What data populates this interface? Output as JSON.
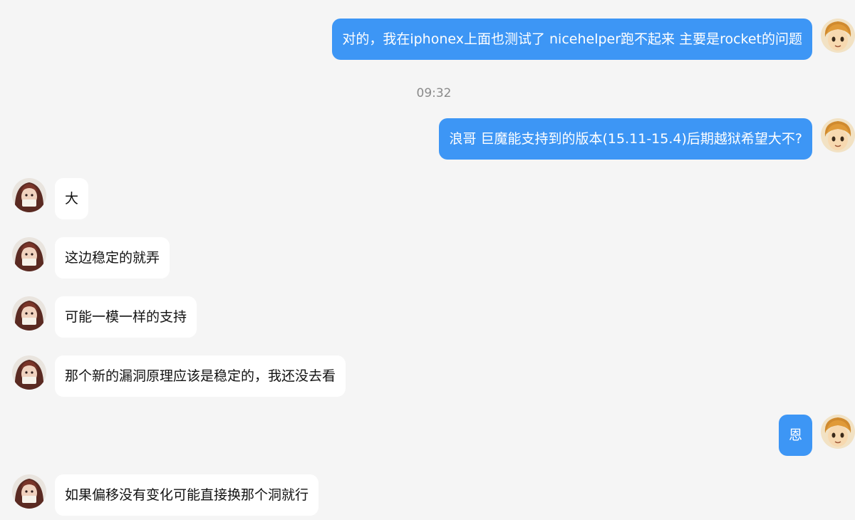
{
  "chat": {
    "messages": [
      {
        "side": "out",
        "text": "对的，我在iphonex上面也测试了 nicehelper跑不起来 主要是rocket的问题"
      },
      {
        "side": "out",
        "text": "浪哥 巨魔能支持到的版本(15.11-15.4)后期越狱希望大不?"
      },
      {
        "side": "in",
        "text": "大"
      },
      {
        "side": "in",
        "text": "这边稳定的就弄"
      },
      {
        "side": "in",
        "text": "可能一模一样的支持"
      },
      {
        "side": "in",
        "text": "那个新的漏洞原理应该是稳定的，我还没去看"
      },
      {
        "side": "out",
        "text": "恩"
      },
      {
        "side": "in",
        "text": "如果偏移没有变化可能直接换那个洞就行"
      }
    ],
    "timestamp": "09:32"
  },
  "colors": {
    "outgoing_bubble": "#3d96f5",
    "incoming_bubble": "#ffffff",
    "background": "#f5f5f5"
  },
  "avatars": {
    "self": "cartoon-boy-avatar-icon",
    "contact": "anime-character-avatar-icon"
  }
}
